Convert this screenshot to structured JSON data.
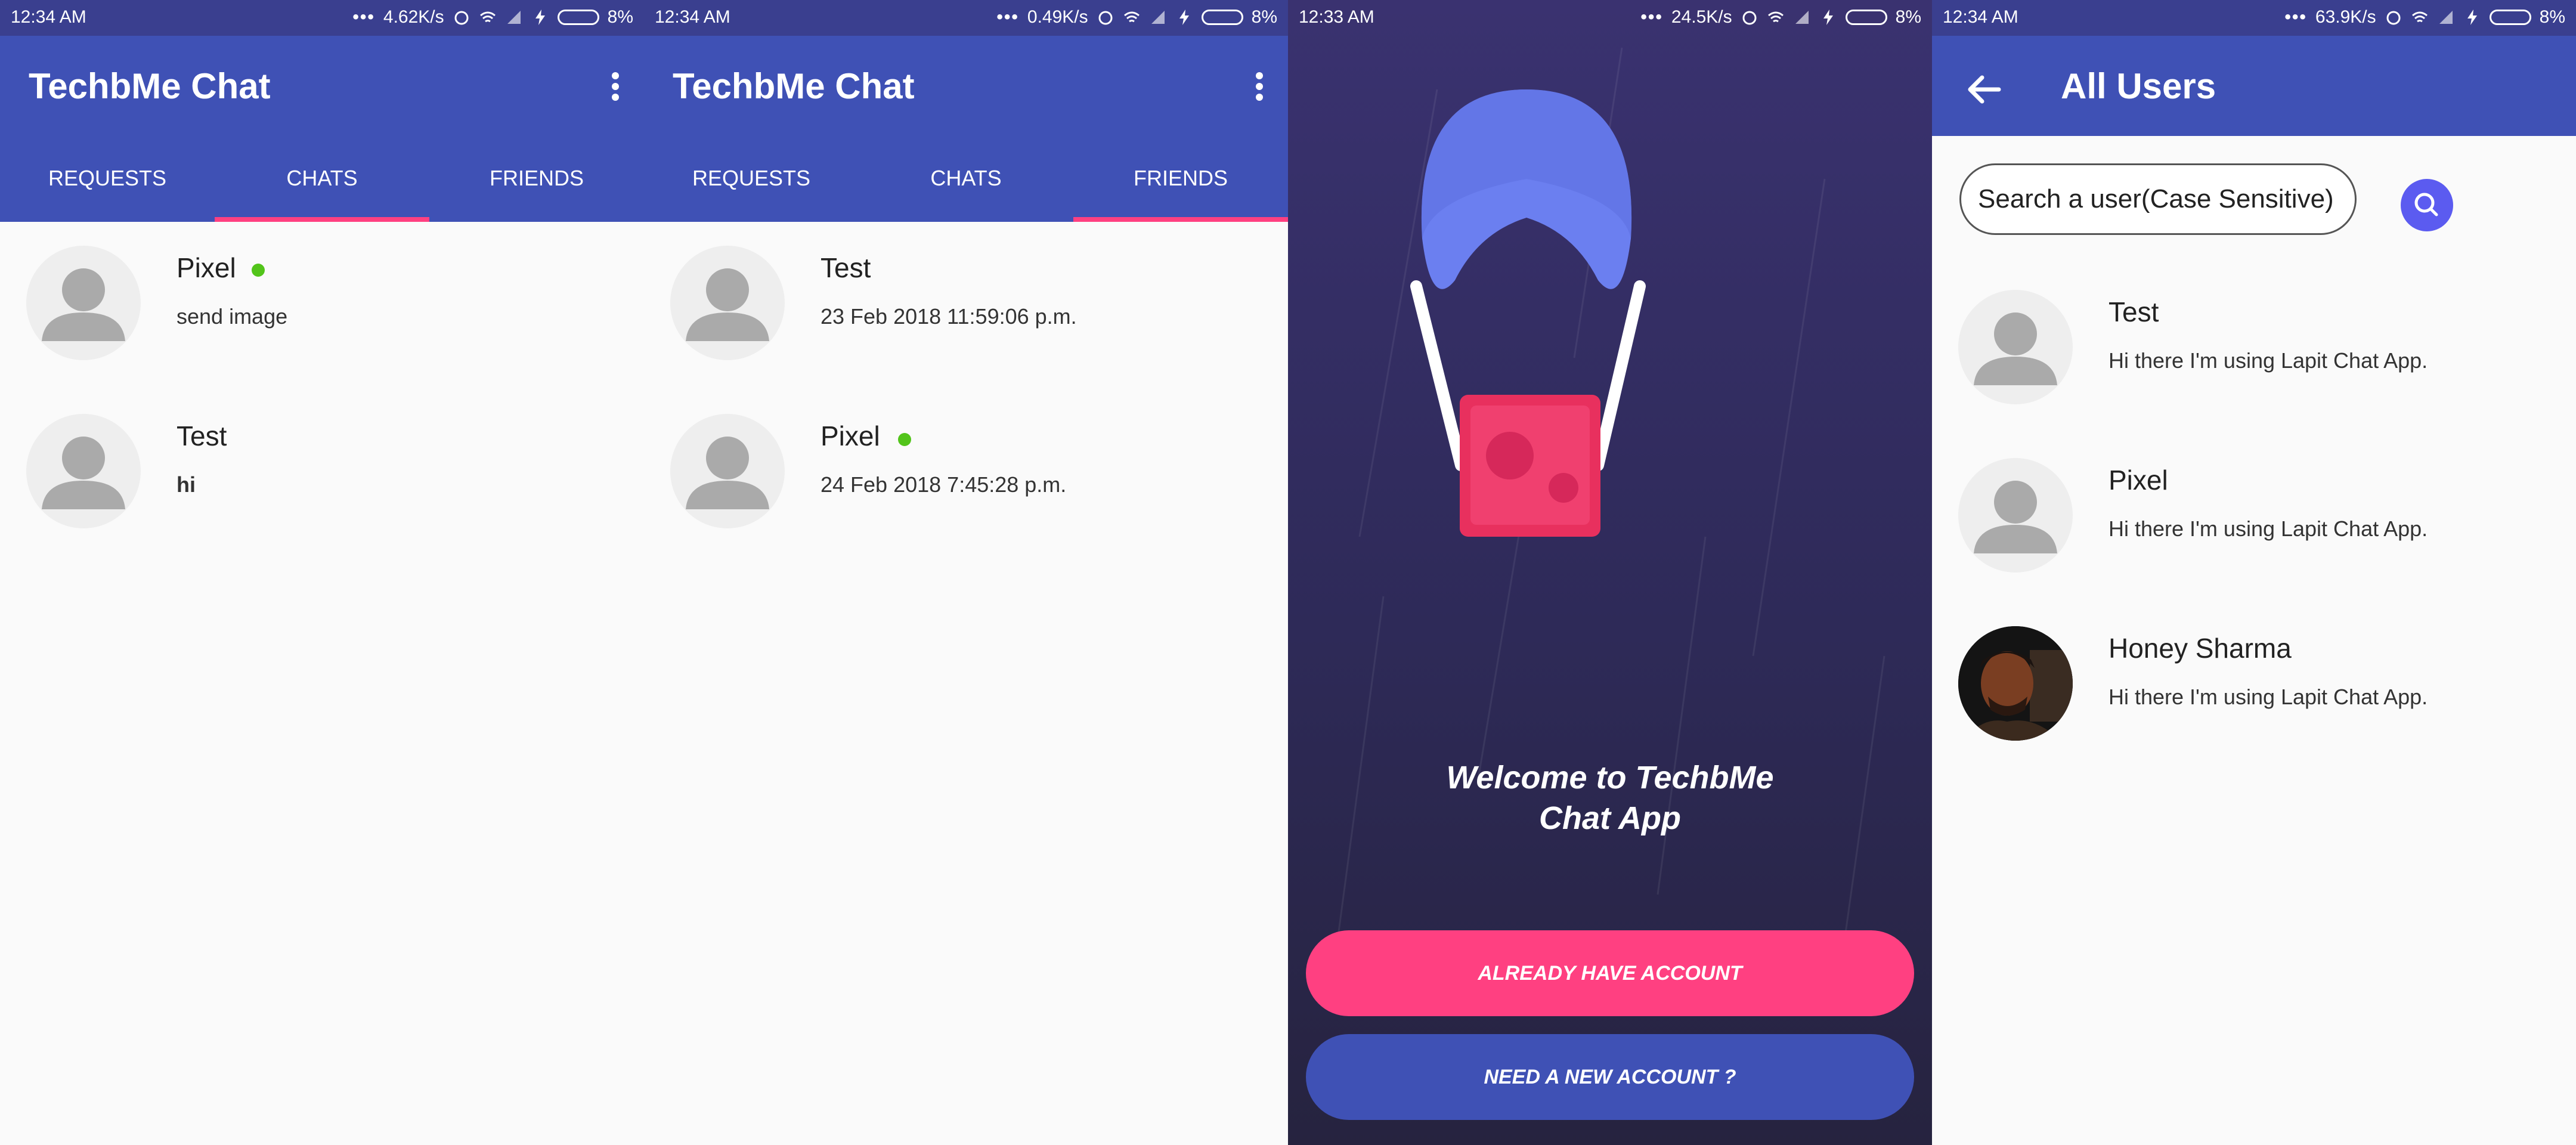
{
  "colors": {
    "primary": "#3f51b5",
    "status_bar": "#3a3f8f",
    "accent": "#ff4081",
    "online": "#52c41a",
    "search_button": "#5b5bf0"
  },
  "screens": [
    {
      "status": {
        "time": "12:34 AM",
        "speed": "4.62K/s",
        "battery": "8%"
      },
      "title": "TechbMe Chat",
      "tabs": [
        "REQUESTS",
        "CHATS",
        "FRIENDS"
      ],
      "active_tab": "CHATS",
      "rows": [
        {
          "name": "Pixel",
          "online": true,
          "subtitle": "send image"
        },
        {
          "name": "Test",
          "online": false,
          "subtitle": "hi"
        }
      ]
    },
    {
      "status": {
        "time": "12:34 AM",
        "speed": "0.49K/s",
        "battery": "8%"
      },
      "title": "TechbMe Chat",
      "tabs": [
        "REQUESTS",
        "CHATS",
        "FRIENDS"
      ],
      "active_tab": "FRIENDS",
      "rows": [
        {
          "name": "Test",
          "online": false,
          "subtitle": "23 Feb 2018 11:59:06 p.m."
        },
        {
          "name": "Pixel",
          "online": true,
          "subtitle": "24 Feb 2018 7:45:28 p.m."
        }
      ]
    },
    {
      "status": {
        "time": "12:33 AM",
        "speed": "24.5K/s",
        "battery": "8%"
      },
      "welcome_line1": "Welcome to TechbMe",
      "welcome_line2": "Chat App",
      "login_button": "ALREADY HAVE ACCOUNT",
      "register_button": "NEED A NEW ACCOUNT ?"
    },
    {
      "status": {
        "time": "12:34 AM",
        "speed": "63.9K/s",
        "battery": "8%"
      },
      "title": "All Users",
      "search_value": "Search a user(Case Sensitive)",
      "users": [
        {
          "name": "Test",
          "status": "Hi there I'm using Lapit Chat App.",
          "photo": false
        },
        {
          "name": "Pixel",
          "status": "Hi there I'm using Lapit Chat App.",
          "photo": false
        },
        {
          "name": "Honey Sharma",
          "status": "Hi there I'm using Lapit Chat App.",
          "photo": true
        }
      ]
    }
  ]
}
